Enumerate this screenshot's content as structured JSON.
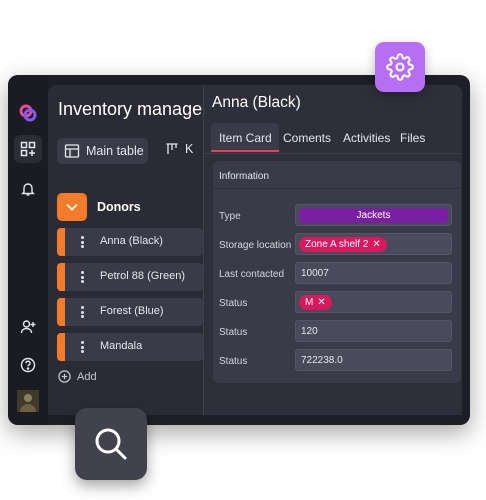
{
  "app": {
    "title": "Inventory manage"
  },
  "left": {
    "tabs": [
      {
        "label": "Main table"
      },
      {
        "label": "K"
      }
    ],
    "group": {
      "label": "Donors"
    },
    "items": [
      {
        "label": "Anna (Black)"
      },
      {
        "label": "Petrol 88 (Green)"
      },
      {
        "label": "Forest (Blue)"
      },
      {
        "label": "Mandala"
      }
    ],
    "add_label": "Add"
  },
  "detail": {
    "title": "Anna (Black)",
    "tabs": [
      {
        "label": "Item Card"
      },
      {
        "label": "Coments"
      },
      {
        "label": "Activities"
      },
      {
        "label": "Files"
      }
    ],
    "section": "Information",
    "fields": [
      {
        "label": "Type",
        "value": "Jackets"
      },
      {
        "label": "Storage location",
        "value": "Zone A shelf 2"
      },
      {
        "label": "Last contacted",
        "value": "10007"
      },
      {
        "label": "Status",
        "value": "M"
      },
      {
        "label": "Status",
        "value": "120"
      },
      {
        "label": "Status",
        "value": "722238.0"
      }
    ]
  },
  "colors": {
    "accent_orange": "#f47b2a",
    "accent_pink": "#e0425e",
    "tag_purple": "#7a1fa2",
    "chip_pink": "#d9185e",
    "gear_bg": "#b66ef5"
  },
  "icons": {
    "logo": "app-logo-icon",
    "apps": "apps-grid-icon",
    "bell": "bell-icon",
    "add_user": "add-user-icon",
    "help": "help-icon",
    "settings": "gear-icon",
    "search": "search-icon"
  }
}
